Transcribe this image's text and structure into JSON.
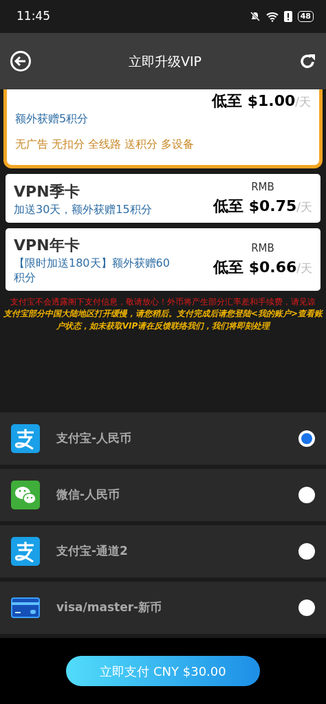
{
  "status_bar": {
    "time": "11:45",
    "battery": "48"
  },
  "header": {
    "title": "立即升级VIP"
  },
  "plans": [
    {
      "highlighted": true,
      "desc": "额外获赠5积分",
      "features": "无广告 无扣分 全线路 送积分 多设备",
      "price_prefix": "低至",
      "price": "$1.00",
      "unit": "/天"
    },
    {
      "highlighted": false,
      "name": "VPN季卡",
      "desc": "加送30天，额外获赠15积分",
      "currency": "RMB",
      "price_prefix": "低至",
      "price": "$0.75",
      "unit": "/天"
    },
    {
      "highlighted": false,
      "name": "VPN年卡",
      "desc": "【限时加送180天】额外获赠60积分",
      "currency": "RMB",
      "price_prefix": "低至",
      "price": "$0.66",
      "unit": "/天"
    }
  ],
  "notices": [
    {
      "text": "支付宝不会透露阁下支付信息，敬请放心！外币将产生部分汇率差和手续费，请见谅",
      "color": "#e01b1b"
    },
    {
      "text": "支付宝部分中国大陆地区打开缓慢，请您稍后。支付完成后请您登陆<我的账户>查看账户状态，如未获取VIP请在反馈联络我们，我们将即刻处理",
      "color": "#f0b400"
    }
  ],
  "payments": [
    {
      "kind": "alipay",
      "label": "支付宝-人民币",
      "selected": true
    },
    {
      "kind": "wechat",
      "label": "微信-人民币",
      "selected": false
    },
    {
      "kind": "alipay",
      "label": "支付宝-通道2",
      "selected": false
    },
    {
      "kind": "card",
      "label": "visa/master-新币",
      "selected": false
    }
  ],
  "pay_button": "立即支付 CNY $30.00"
}
